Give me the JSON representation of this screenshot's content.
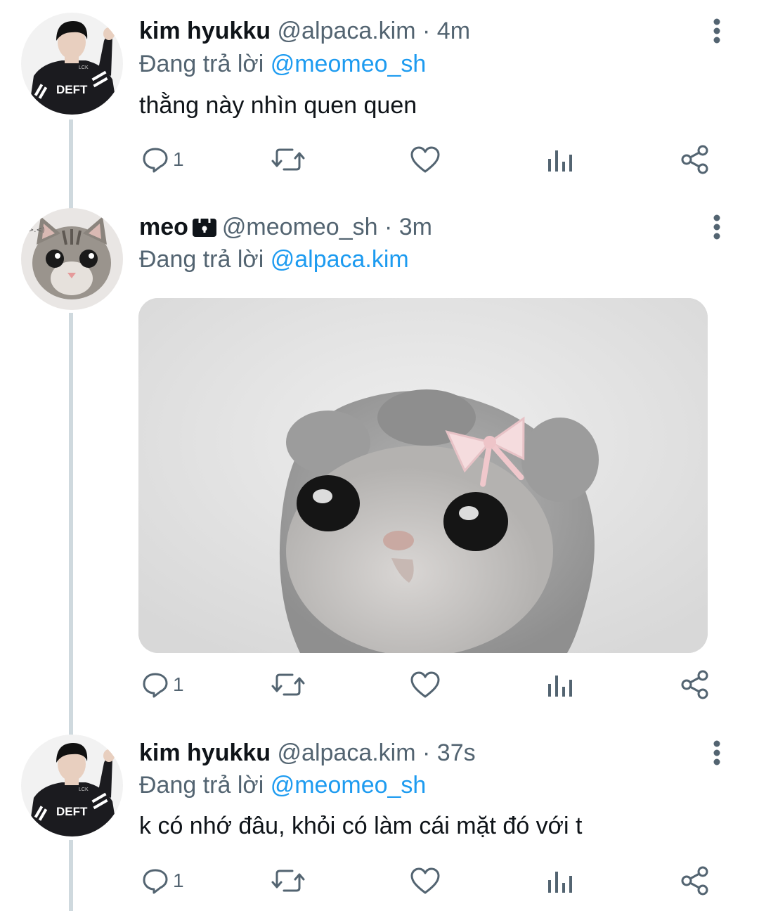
{
  "tweets": [
    {
      "name": "kim hyukku",
      "handle": "@alpaca.kim",
      "time": "4m",
      "reply_prefix": "Đang trả lời",
      "reply_to": "@meomeo_sh",
      "text": "thằng này nhìn quen quen",
      "avatar_jersey_text": "DEFT",
      "avatar_logo_text": "LCK",
      "reply_count": "1",
      "icons": [
        "reply-icon",
        "retweet-icon",
        "like-icon",
        "views-icon",
        "share-icon"
      ]
    },
    {
      "name": "meo",
      "handle": "@meomeo_sh",
      "time": "3m",
      "reply_prefix": "Đang trả lời",
      "reply_to": "@alpaca.kim",
      "text": "",
      "avatar_sticker_text": "(>.<)",
      "media_description": "hamster with pink bow",
      "reply_count": "1",
      "protected": true,
      "icons": [
        "reply-icon",
        "retweet-icon",
        "like-icon",
        "views-icon",
        "share-icon"
      ]
    },
    {
      "name": "kim hyukku",
      "handle": "@alpaca.kim",
      "time": "37s",
      "reply_prefix": "Đang trả lời",
      "reply_to": "@meomeo_sh",
      "text": "k có nhớ đâu, khỏi có làm cái mặt đó với t",
      "avatar_jersey_text": "DEFT",
      "avatar_logo_text": "LCK",
      "reply_count": "1",
      "icons": [
        "reply-icon",
        "retweet-icon",
        "like-icon",
        "views-icon",
        "share-icon"
      ]
    }
  ],
  "colors": {
    "mention": "#1d9bf0",
    "secondary_text": "#536471",
    "primary_text": "#0f1419",
    "thread_line": "#cfd9de"
  },
  "separator": " · "
}
